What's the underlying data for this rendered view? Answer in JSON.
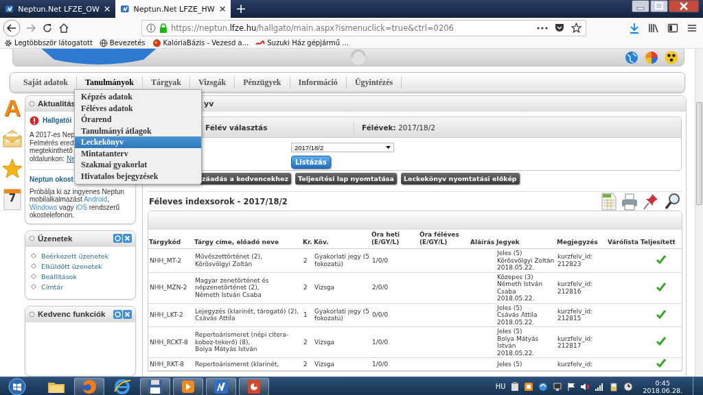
{
  "browser": {
    "tabs": [
      {
        "label": "Neptun.Net LFZE_OW",
        "selected": false
      },
      {
        "label": "Neptun.Net LFZE_HW",
        "selected": true
      }
    ],
    "url": "https://neptun.**lfze.hu**/hallgato/main.aspx?ismenuclick=true&ctrl=0206",
    "bookmarks": [
      {
        "kind": "gear",
        "label": "Legtöbbször látogatott"
      },
      {
        "kind": "globe",
        "label": "Bevezetés"
      },
      {
        "kind": "fruit",
        "label": "KalóriaBázis - Vezesd a..."
      },
      {
        "kind": "swoosh",
        "label": "Suzuki Ház gépjármű ..."
      }
    ]
  },
  "menu": {
    "items": [
      {
        "label": "Saját adatok",
        "selected": false
      },
      {
        "label": "Tanulmányok",
        "selected": true
      },
      {
        "label": "Tárgyak",
        "selected": false
      },
      {
        "label": "Vizsgák",
        "selected": false
      },
      {
        "label": "Pénzügyek",
        "selected": false
      },
      {
        "label": "Információ",
        "selected": false
      },
      {
        "label": "Ügyintézés",
        "selected": false
      }
    ],
    "dropdown": [
      {
        "label": "Képzés adatok",
        "selected": false
      },
      {
        "label": "Féléves adatok",
        "selected": false
      },
      {
        "label": "Órarend",
        "selected": false
      },
      {
        "label": "Tanulmányi átlagok",
        "selected": false
      },
      {
        "label": "Leckekönyv",
        "selected": true
      },
      {
        "label": "Mintatanterv",
        "selected": false
      },
      {
        "label": "Szakmai gyakorlat",
        "selected": false
      },
      {
        "label": "Hivatalos bejegyzések",
        "selected": false
      }
    ]
  },
  "sidebar": {
    "icons": [
      {
        "kind": "letter",
        "text": "A"
      },
      {
        "kind": "envelope"
      },
      {
        "kind": "star"
      },
      {
        "kind": "calendar",
        "text": "7"
      }
    ],
    "news": {
      "title": "Aktualitás",
      "alert": "Hallgatói",
      "lines": [
        {
          "text": "A 2017-es Nep"
        },
        {
          "text": "Felmérés ered"
        },
        {
          "text": "megtekinthető"
        },
        {
          "text": "oldalunkon:",
          "link": "Ne"
        }
      ],
      "app_title": "Neptun okost",
      "app_text": [
        {
          "text": "Próbálja ki az ingyenes Neptun mobilalkalmazást "
        },
        {
          "link": "Android"
        },
        {
          "text": ", "
        },
        {
          "link": "Windows"
        },
        {
          "text": " vagy "
        },
        {
          "link": "iOS"
        },
        {
          "text": " rendszerű okostelefonon."
        }
      ]
    },
    "messages": {
      "title": "Üzenetek",
      "links": [
        "Beérkezett üzenetek",
        "Elküldött üzenetek",
        "Beállítások",
        "Címtár"
      ]
    },
    "favorites": {
      "title": "Kedvenc funkciók"
    }
  },
  "main": {
    "panel_title": "yv",
    "selector": {
      "label": "Félév választás",
      "semesters_label": "Félévek:",
      "semesters_value": "2017/18/2",
      "select_value": "2017/18/2",
      "list_button": "Listázás"
    },
    "actions": [
      "záadás a kedvencekhez",
      "Teljesítési lap nyomtatása",
      "Leckekönyv nyomtatási előkép"
    ],
    "heading": "Féleves indexsorok - 2017/18/2",
    "table": {
      "columns": [
        "Tárgykód",
        "Tárgy címe, előadó neve",
        "Kr.",
        "Köv.",
        "Óra heti (E/GY/L)",
        "Óra féléves (E/GY/L)",
        "Aláírás",
        "Jegyek",
        "Megjegyzés",
        "Várólista",
        "Teljesített"
      ],
      "rows": [
        {
          "code": "NHH_MT-2",
          "title": [
            "Művészettörténet (2),",
            "Körösvölgyi Zoltán"
          ],
          "credits": "2",
          "requirement": [
            "Gyakorlati jegy (5",
            "fokozatú)"
          ],
          "weekly": "1/0/0",
          "grades": [
            "Jeles (5)",
            "Körösvölgyi Zoltán",
            "2018.05.22."
          ],
          "note": [
            "kurzfelv_id:",
            "212823"
          ],
          "completed": true
        },
        {
          "code": "NHH_MZN-2",
          "title": [
            "Magyar zenetörténet és",
            "népzenetörténet (2),",
            "Németh István Csaba"
          ],
          "credits": "2",
          "requirement": [
            "Vizsga"
          ],
          "weekly": "2/0/0",
          "grades": [
            "Közepes (3)",
            "Németh István",
            "Csaba",
            "2018.05.22."
          ],
          "note": [
            "kurzfelv_id:",
            "212816"
          ],
          "completed": true
        },
        {
          "code": "NHH_LKT-2",
          "title": [
            "Lejegyzés (klarinét, tárogató) (2),",
            "Csávás Attila"
          ],
          "credits": "1",
          "requirement": [
            "Gyakorlati jegy (5",
            "fokozatú)"
          ],
          "weekly": "0/0/0",
          "grades": [
            "Jeles (5)",
            "Csávás Attila",
            "2018.05.22."
          ],
          "note": [
            "kurzfelv_id:",
            "212815"
          ],
          "completed": true
        },
        {
          "code": "NHH_RCKT-8",
          "title": [
            "Repertoárismeret (népi citera-",
            "koboz-tekerő) (8),",
            "Bolya Mátyás István"
          ],
          "credits": "2",
          "requirement": [
            "Vizsga"
          ],
          "weekly": "1/0/0",
          "grades": [
            "Jeles (5)",
            "Bolya Mátyás",
            "István",
            "2018.05.22."
          ],
          "note": [
            "kurzfelv_id:",
            "212817"
          ],
          "completed": true
        },
        {
          "code": "NHH_RKT-8",
          "title": [
            "Repertoárismeret (klarinét,"
          ],
          "credits": "2",
          "requirement": [
            "Vizsga"
          ],
          "weekly": "1/0/0",
          "grades": [
            "Jeles (5)"
          ],
          "note": [
            "kurzfelv_id:"
          ],
          "completed": true
        }
      ]
    }
  },
  "taskbar": {
    "apps": [
      {
        "kind": "folder",
        "running": false
      },
      {
        "kind": "firefox",
        "running": true
      },
      {
        "kind": "ie",
        "running": false
      },
      {
        "kind": "disk",
        "running": true
      },
      {
        "kind": "media",
        "running": true
      },
      {
        "kind": "neptun",
        "running": true
      },
      {
        "kind": "slides",
        "running": true
      }
    ],
    "language": "HU",
    "time": "0:45",
    "date": "2018.06.28."
  }
}
